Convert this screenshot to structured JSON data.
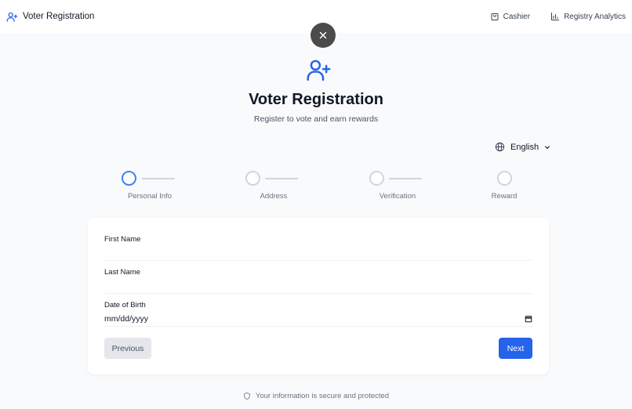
{
  "header": {
    "brand_label": "Voter Registration",
    "nav": [
      {
        "label": "Cashier",
        "icon": "shopping-bag-icon"
      },
      {
        "label": "Registry Analytics",
        "icon": "bar-chart-icon"
      }
    ]
  },
  "hero": {
    "icon": "user-plus-icon",
    "title": "Voter Registration",
    "subtitle": "Register to vote and earn rewards"
  },
  "language": {
    "selected": "English",
    "icon": "globe-icon"
  },
  "steps": [
    {
      "label": "Personal Info",
      "active": true
    },
    {
      "label": "Address",
      "active": false
    },
    {
      "label": "Verification",
      "active": false
    },
    {
      "label": "Reward",
      "active": false
    }
  ],
  "form": {
    "first_name_label": "First Name",
    "first_name_value": "",
    "last_name_label": "Last Name",
    "last_name_value": "",
    "dob_label": "Date of Birth",
    "dob_placeholder": "mm/dd/yyyy",
    "previous_label": "Previous",
    "next_label": "Next"
  },
  "footer": {
    "note": "Your information is secure and protected",
    "icon": "shield-icon"
  },
  "colors": {
    "accent": "#2563eb",
    "active_step": "#3b82f6",
    "close_bg": "#4b4b4b"
  }
}
